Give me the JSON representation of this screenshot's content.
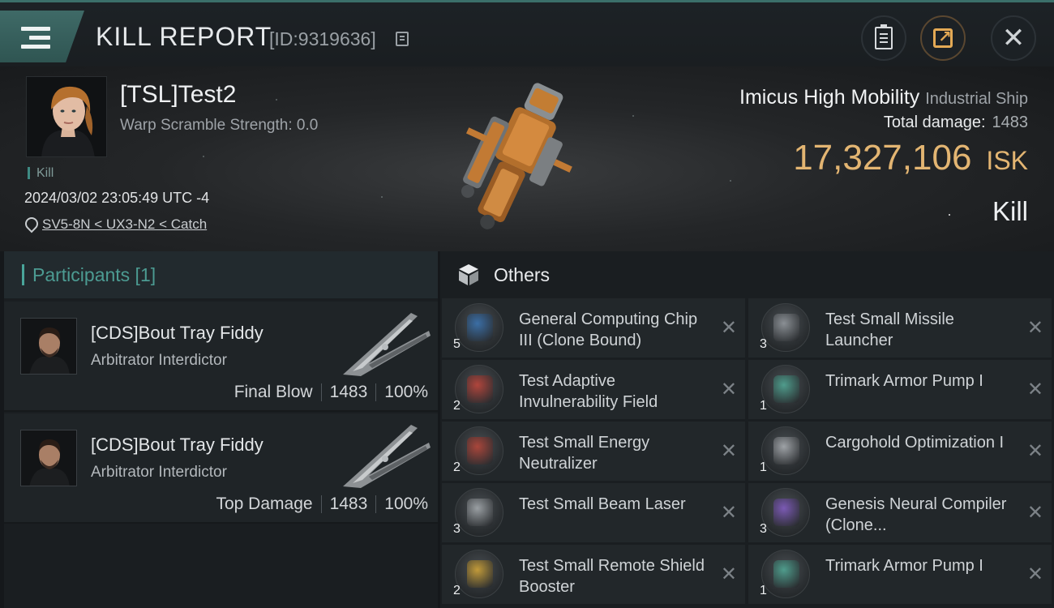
{
  "header": {
    "title": "KILL REPORT",
    "report_id": "[ID:9319636]"
  },
  "victim": {
    "name": "[TSL]Test2",
    "warp_scramble": "Warp Scramble Strength: 0.0",
    "tag": "Kill",
    "datetime": "2024/03/02 23:05:49 UTC -4",
    "location": "SV5-8N < UX3-N2 < Catch",
    "ship_name": "Imicus High Mobility",
    "ship_class": "Industrial Ship",
    "total_damage_label": "Total damage:",
    "total_damage_value": "1483",
    "isk_value": "17,327,106",
    "isk_unit": "ISK",
    "result": "Kill"
  },
  "participants": {
    "title": "Participants [1]",
    "rows": [
      {
        "name": "[CDS]Bout Tray Fiddy",
        "ship": "Arbitrator Interdictor",
        "role": "Final Blow",
        "damage": "1483",
        "percent": "100%"
      },
      {
        "name": "[CDS]Bout Tray Fiddy",
        "ship": "Arbitrator Interdictor",
        "role": "Top Damage",
        "damage": "1483",
        "percent": "100%"
      }
    ]
  },
  "others": {
    "title": "Others",
    "items": [
      {
        "name": "General Computing Chip III (Clone Bound)",
        "qty": "5",
        "icon": "chip-icon",
        "color": "#3b6ea5"
      },
      {
        "name": "Test Small Missile Launcher",
        "qty": "3",
        "icon": "missile-launcher-icon",
        "color": "#8a8f94"
      },
      {
        "name": "Test Adaptive Invulnerability Field",
        "qty": "2",
        "icon": "shield-field-icon",
        "color": "#b0453c"
      },
      {
        "name": "Trimark Armor Pump I",
        "qty": "1",
        "icon": "armor-pump-icon",
        "color": "#4f9c8c"
      },
      {
        "name": "Test Small Energy Neutralizer",
        "qty": "2",
        "icon": "energy-neutralizer-icon",
        "color": "#a9463b"
      },
      {
        "name": "Cargohold Optimization I",
        "qty": "1",
        "icon": "cargohold-icon",
        "color": "#9ea2a6"
      },
      {
        "name": "Test Small Beam Laser",
        "qty": "3",
        "icon": "beam-laser-icon",
        "color": "#9a9fa3"
      },
      {
        "name": "Genesis Neural Compiler (Clone...",
        "qty": "3",
        "icon": "neural-compiler-icon",
        "color": "#7b5ab4"
      },
      {
        "name": "Test Small Remote Shield Booster",
        "qty": "2",
        "icon": "shield-booster-icon",
        "color": "#c19a3a"
      },
      {
        "name": "Trimark Armor Pump I",
        "qty": "1",
        "icon": "armor-pump-icon",
        "color": "#4f9c8c"
      }
    ]
  }
}
